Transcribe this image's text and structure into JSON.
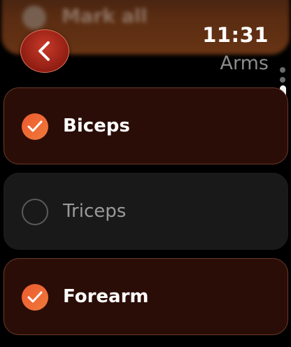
{
  "header": {
    "mark_all_label": "Mark all",
    "time": "11:31",
    "title": "Arms"
  },
  "icons": {
    "back": "chevron-left-icon",
    "check": "checkmark-icon"
  },
  "colors": {
    "accent": "#ec5a30",
    "checked_row_bg": "#2b0d07",
    "unchecked_row_bg": "#191919",
    "back_button": "#a8261a"
  },
  "items": [
    {
      "label": "Biceps",
      "checked": true
    },
    {
      "label": "Triceps",
      "checked": false
    },
    {
      "label": "Forearm",
      "checked": true
    }
  ]
}
